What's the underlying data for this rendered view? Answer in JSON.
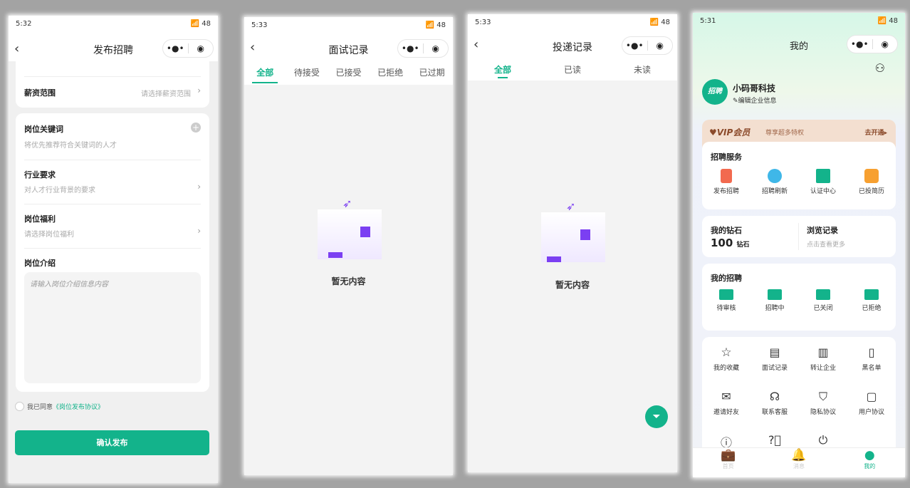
{
  "status": {
    "p1": "5:32",
    "p2": "5:33",
    "p3": "5:33",
    "p4": "5:31",
    "battery": "48"
  },
  "capsule": {
    "more": "•●•",
    "target": "◉"
  },
  "publish": {
    "title": "发布招聘",
    "rows": [
      {
        "label": "薪资范围",
        "hint": "请选择薪资范围"
      }
    ],
    "keywords": {
      "label": "岗位关键词",
      "hint": "将优先推荐符合关键词的人才"
    },
    "industry": {
      "label": "行业要求",
      "hint": "对人才行业背景的要求"
    },
    "welfare": {
      "label": "岗位福利",
      "hint": "请选择岗位福利"
    },
    "intro": {
      "label": "岗位介绍",
      "placeholder": "请输入岗位介绍信息内容"
    },
    "agree": "我已同意",
    "agreement": "《岗位发布协议》",
    "submit": "确认发布"
  },
  "interview": {
    "title": "面试记录",
    "tabs": [
      "全部",
      "待接受",
      "已接受",
      "已拒绝",
      "已过期"
    ],
    "empty": "暂无内容"
  },
  "delivery": {
    "title": "投递记录",
    "tabs": [
      "全部",
      "已读",
      "未读"
    ],
    "empty": "暂无内容"
  },
  "mine": {
    "title": "我的",
    "logo": "招聘",
    "company": "小码哥科技",
    "edit": "编辑企业信息",
    "vip": {
      "title": "VIP会员",
      "sub": "尊享超多特权",
      "action": "去开通"
    },
    "services": {
      "title": "招聘服务",
      "items": [
        "发布招聘",
        "招聘刷新",
        "认证中心",
        "已投简历"
      ]
    },
    "diamond": {
      "title": "我的钻石",
      "value": "100",
      "unit": "钻石"
    },
    "history": {
      "title": "浏览记录",
      "hint": "点击查看更多"
    },
    "recruit": {
      "title": "我的招聘",
      "items": [
        "待审核",
        "招聘中",
        "已关闭",
        "已拒绝"
      ]
    },
    "tools": [
      "我的收藏",
      "面试记录",
      "转让企业",
      "黑名单",
      "邀请好友",
      "联系客服",
      "隐私协议",
      "用户协议"
    ],
    "tabbar": [
      "首页",
      "消息",
      "我的"
    ]
  },
  "colors": {
    "accent": "#13b38b",
    "purple": "#7b3ff2"
  }
}
